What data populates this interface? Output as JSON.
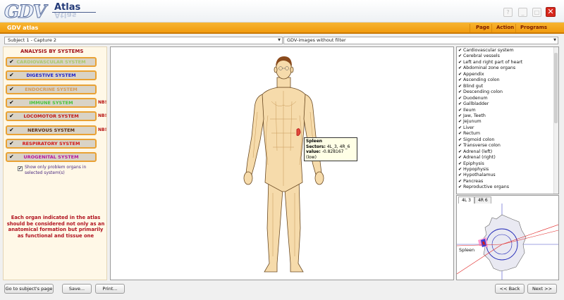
{
  "app": {
    "logo_text": "GDV",
    "logo_sub": "Atlas",
    "panel_title": "GDV atlas"
  },
  "menu": {
    "page": "Page",
    "action": "Action",
    "programs": "Programs"
  },
  "window_controls": {
    "help": "?",
    "minimize": "_",
    "maximize": "□",
    "close": "✕"
  },
  "selectors": {
    "subject": "Subject 1 - Capture 2",
    "filter": "GDV-images without filter"
  },
  "left": {
    "title": "ANALYSIS BY SYSTEMS",
    "systems": [
      {
        "label": "CARDIOVASCULAR SYSTEM",
        "color": "#a9c96a",
        "nb": ""
      },
      {
        "label": "DIGESTIVE SYSTEM",
        "color": "#1d1fc8",
        "nb": ""
      },
      {
        "label": "ENDOCRINE SYSTEM",
        "color": "#d79a54",
        "nb": ""
      },
      {
        "label": "IMMUNE SYSTEM",
        "color": "#47c33a",
        "nb": "NB!"
      },
      {
        "label": "LOCOMOTOR SYSTEM",
        "color": "#c01717",
        "nb": "NB!"
      },
      {
        "label": "NERVOUS SYSTEM",
        "color": "#5a2d12",
        "nb": "NB!"
      },
      {
        "label": "RESPIRATORY SYSTEM",
        "color": "#d21616",
        "nb": ""
      },
      {
        "label": "UROGENITAL SYSTEM",
        "color": "#b5159d",
        "nb": ""
      }
    ],
    "option_label": "Show only problem organs in selected system(s)",
    "note": "Each organ indicated in the atlas should be considered not only as an anatomical formation but primarily as functional and tissue one"
  },
  "tooltip": {
    "organ": "Spleen",
    "sectors_label": "Sectors:",
    "sectors": "4L_3, 4R_6",
    "value_label": "value:",
    "value": "-0.828167 (low)"
  },
  "organs": [
    "Cardiovascular system",
    "Cerebral vessels",
    "Left and right part of heart",
    "Abdominal zone organs",
    "Appendix",
    "Ascending colon",
    "Blind gut",
    "Descending colon",
    "Duodenum",
    "Gallbladder",
    "Ileum",
    "Jaw, Teeth",
    "Jejunum",
    "Liver",
    "Rectum",
    "Sigmoid colon",
    "Transverse colon",
    "Adrenal (left)",
    "Adrenal (right)",
    "Epiphysis",
    "Hypophysis",
    "Hypothalamus",
    "Pancreas",
    "Reproductive organs"
  ],
  "sector_tabs": [
    "4L 3",
    "4R 6"
  ],
  "sector_label": "Spleen",
  "buttons": {
    "goto": "Go to subject's page",
    "save": "Save...",
    "print": "Print...",
    "back": "<< Back",
    "next": "Next >>"
  },
  "colors": {
    "accent_orange": "#f19b0e",
    "skin": "#f5d9a8",
    "nerve": "#c89a5a"
  },
  "checkmark": "✔"
}
